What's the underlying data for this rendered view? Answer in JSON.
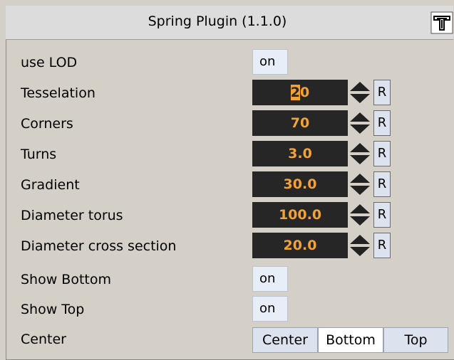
{
  "window": {
    "title": "Spring Plugin (1.1.0)"
  },
  "params": [
    {
      "label": "use LOD",
      "type": "toggle",
      "value": "on"
    },
    {
      "label": "Tesselation",
      "type": "number",
      "value_pre": "",
      "value_sel": "2",
      "value_post": "0",
      "reset": "R"
    },
    {
      "label": "Corners",
      "type": "number",
      "value": "70",
      "reset": "R"
    },
    {
      "label": "Turns",
      "type": "number",
      "value": "3.0",
      "reset": "R"
    },
    {
      "label": "Gradient",
      "type": "number",
      "value": "30.0",
      "reset": "R"
    },
    {
      "label": "Diameter torus",
      "type": "number",
      "value": "100.0",
      "reset": "R"
    },
    {
      "label": "Diameter cross section",
      "type": "number",
      "value": "20.0",
      "reset": "R"
    },
    {
      "label": "Show Bottom",
      "type": "toggle",
      "value": "on"
    },
    {
      "label": "Show Top",
      "type": "toggle",
      "value": "on"
    },
    {
      "label": "Center",
      "type": "segmented",
      "options": [
        "Center",
        "Bottom",
        "Top"
      ],
      "selected": "Bottom"
    }
  ],
  "colors": {
    "field_bg": "#262626",
    "field_text": "#f2a238",
    "panel_bg": "#d4d0c8"
  },
  "icons": {
    "plugin": "plugin-icon",
    "spinner": "spinner-arrows-icon"
  }
}
